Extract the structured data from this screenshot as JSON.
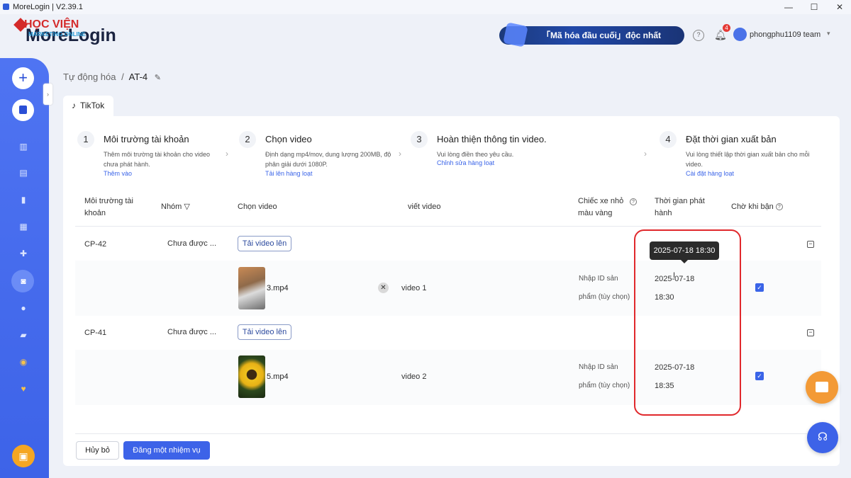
{
  "window": {
    "title": "MoreLogin | V2.39.1",
    "min": "—",
    "max": "☐",
    "close": "✕"
  },
  "brand": {
    "hv": "HỌC VIỆN",
    "hv_sub": "MARKETING ONLINE",
    "name": "MoreLogin"
  },
  "header": {
    "banner": "「Mã hóa đầu cuối」độc nhất",
    "help_icon": "?",
    "notification_count": "4",
    "team": "phongphu1109 team",
    "chevron": "▾"
  },
  "sidebar": {
    "plus": "+",
    "icons": [
      "calendar-icon",
      "card-icon",
      "doc-icon",
      "trash-icon",
      "puzzle-icon",
      "robot-icon",
      "users-icon",
      "cart-icon",
      "clock-icon",
      "heart-icon"
    ]
  },
  "breadcrumb": {
    "parent": "Tự động hóa",
    "sep": "/",
    "current": "AT-4"
  },
  "tab": {
    "label": "TikTok"
  },
  "steps": [
    {
      "num": "1",
      "title": "Môi trường tài khoản",
      "desc": "Thêm môi trường tài khoản cho video chưa phát hành.",
      "link": "Thêm vào"
    },
    {
      "num": "2",
      "title": "Chọn video",
      "desc": "Định dạng mp4/mov, dung lượng 200MB, độ phân giải dưới 1080P.",
      "link": "Tải lên hàng loạt"
    },
    {
      "num": "3",
      "title": "Hoàn thiện thông tin video.",
      "desc": "Vui lòng điền theo yêu cầu.",
      "link": "Chỉnh sửa hàng loạt"
    },
    {
      "num": "4",
      "title": "Đặt thời gian xuất bản",
      "desc": "Vui lòng thiết lập thời gian xuất bản cho mỗi video.",
      "link": "Cài đặt hàng loạt"
    }
  ],
  "columns": {
    "env": "Môi trường tài khoản",
    "group": "Nhóm",
    "video": "Chọn video",
    "write": "viết video",
    "cart": "Chiếc xe nhỏ màu vàng",
    "time": "Thời gian phát hành",
    "wait": "Chờ khi bận"
  },
  "groups": [
    {
      "id": "CP-42",
      "select": "Chưa được ...",
      "upload": "Tải video lên",
      "file": "3.mp4",
      "title": "video 1",
      "product": "Nhập ID sản phẩm (tùy chọn)",
      "date": "2025-07-18",
      "time": "18:30"
    },
    {
      "id": "CP-41",
      "select": "Chưa được ...",
      "upload": "Tải video lên",
      "file": "5.mp4",
      "title": "video 2",
      "product": "Nhập ID sản phẩm (tùy chọn)",
      "date": "2025-07-18",
      "time": "18:35"
    }
  ],
  "tooltip": "2025-07-18 18:30",
  "footer": {
    "cancel": "Hủy bỏ",
    "submit": "Đăng một nhiệm vụ"
  },
  "colors": {
    "accent": "#3d63e8",
    "sidebar": "#4f74f2",
    "highlight": "#e0282c",
    "gift": "#f39a36"
  }
}
